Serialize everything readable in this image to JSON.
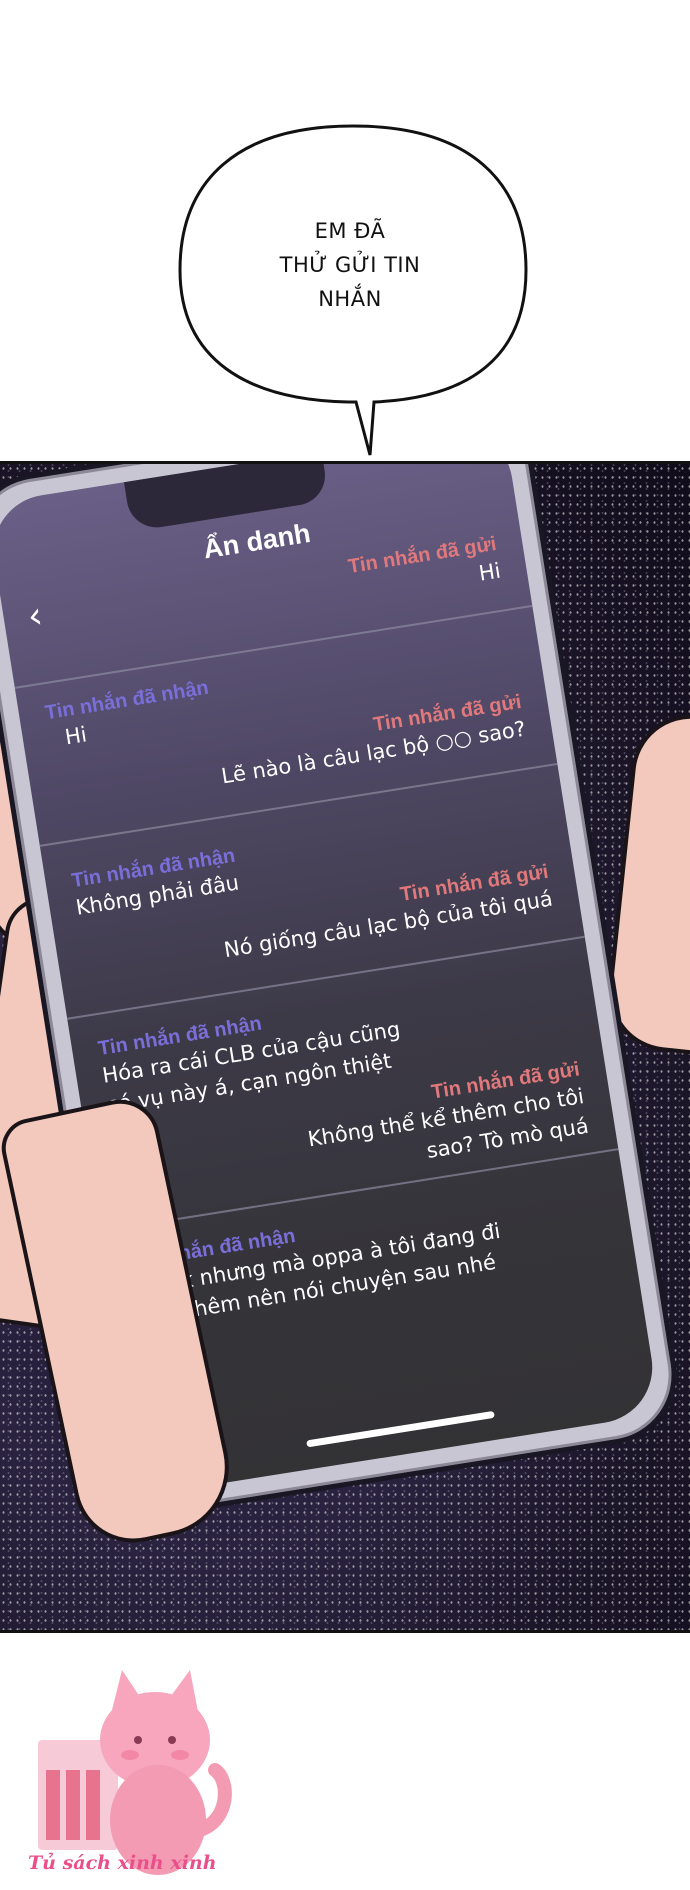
{
  "speech_bubble": {
    "lines": [
      "EM ĐÃ",
      "THỬ GỬI TIN",
      "NHẮN"
    ]
  },
  "chat": {
    "title": "Ẩn danh",
    "back_icon": "chevron-left-icon",
    "sent_label": "Tin nhắn đã gửi",
    "received_label": "Tin nhắn đã nhận",
    "messages": [
      {
        "type": "sent",
        "label": "Tin nhắn đã gửi",
        "text": "Hi"
      },
      {
        "type": "received",
        "label": "Tin nhắn đã nhận",
        "text": "Hi"
      },
      {
        "type": "sent",
        "label": "Tin nhắn đã gửi",
        "text": "Lẽ nào là câu lạc bộ ○○ sao?"
      },
      {
        "type": "received",
        "label": "Tin nhắn đã nhận",
        "text": "Không phải đâu"
      },
      {
        "type": "sent",
        "label": "Tin nhắn đã gửi",
        "text": "Nó giống câu lạc bộ của tôi quá"
      },
      {
        "type": "received",
        "label": "Tin nhắn đã nhận",
        "text": "Hóa ra cái CLB của cậu cũng có vụ này á, cạn ngôn thiệt chứ"
      },
      {
        "type": "sent",
        "label": "Tin nhắn đã gửi",
        "text": "Không thể kể thêm cho tôi sao? Tò mò quá"
      },
      {
        "type": "received",
        "label": "Tin nhắn đã nhận",
        "text": "Kk ok nhưng mà oppa à tôi đang đi làm thêm nên nói chuyện sau nhé"
      }
    ]
  },
  "watermark": {
    "text": "Tủ sách xinh xinh",
    "icon": "pink-cat-logo"
  },
  "colors": {
    "sent_label": "#e1797c",
    "received_label": "#7a6fd8",
    "watermark": "#e94f8a"
  }
}
